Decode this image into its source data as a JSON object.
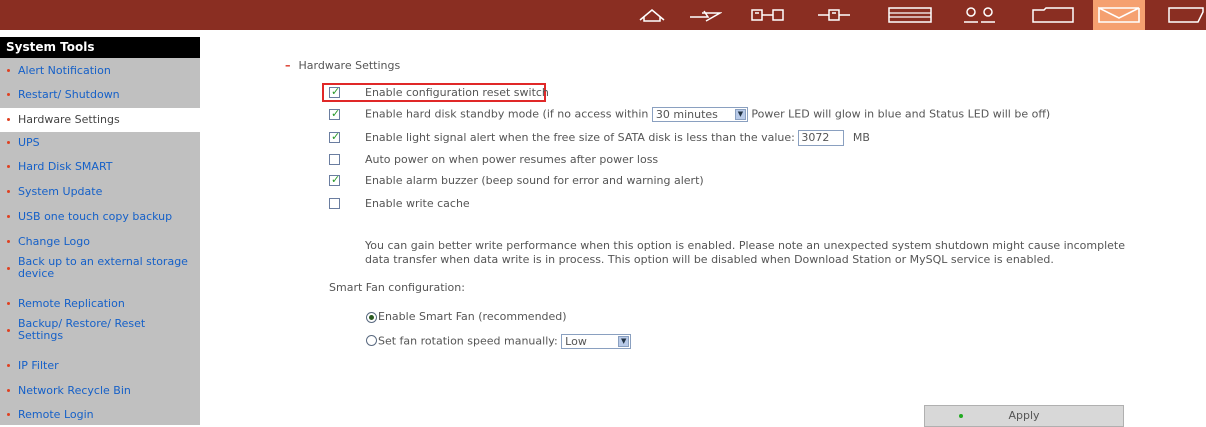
{
  "colors": {
    "topbar": "#8a2e22",
    "topbar_active": "#f5a070",
    "sidebar_bg": "#c0c0c0",
    "link": "#1560c8",
    "highlight": "#e02828"
  },
  "topbar": {
    "icons": [
      "home-icon",
      "shortcut-icon",
      "network-icon",
      "services-icon",
      "storage-icon",
      "users-icon",
      "folder-icon",
      "system-tools-icon",
      "logs-icon"
    ]
  },
  "sidebar": {
    "title": "System Tools",
    "items": [
      {
        "label": "Alert Notification"
      },
      {
        "label": "Restart/ Shutdown"
      },
      {
        "label": "Hardware Settings",
        "active": true
      },
      {
        "label": "UPS"
      },
      {
        "label": "Hard Disk SMART"
      },
      {
        "label": "System Update"
      },
      {
        "label": "USB one touch copy backup"
      },
      {
        "label": "Change Logo"
      },
      {
        "label": "Back up to an external storage device"
      },
      {
        "label": "Remote Replication"
      },
      {
        "label": "Backup/ Restore/ Reset Settings"
      },
      {
        "label": "IP Filter"
      },
      {
        "label": "Network Recycle Bin"
      },
      {
        "label": "Remote Login"
      }
    ]
  },
  "main": {
    "section_title": "Hardware Settings",
    "options": {
      "reset_switch": {
        "label": "Enable configuration reset switch",
        "checked": true
      },
      "standby": {
        "label_before": "Enable hard disk standby mode (if no access within",
        "value": "30 minutes",
        "label_after": "Power LED will glow in blue and Status LED will be off)",
        "checked": true
      },
      "light_alert": {
        "label_before": "Enable light signal alert when the free size of SATA disk is less than the value:",
        "value": "3072",
        "unit": "MB",
        "checked": true
      },
      "auto_power": {
        "label": "Auto power on when power resumes after power loss",
        "checked": false
      },
      "alarm_buzzer": {
        "label": "Enable alarm buzzer (beep sound for error and warning alert)",
        "checked": true
      },
      "write_cache": {
        "label": "Enable write cache",
        "checked": false,
        "description": "You can gain better write performance when this option is enabled. Please note an unexpected system shutdown might cause incomplete data transfer when data write is in process. This option will be disabled when Download Station or MySQL service is enabled."
      }
    },
    "fan": {
      "title": "Smart Fan configuration:",
      "smart_label": "Enable Smart Fan (recommended)",
      "manual_label": "Set fan rotation speed manually:",
      "speed_value": "Low",
      "selected": "smart"
    },
    "apply_label": "Apply"
  }
}
